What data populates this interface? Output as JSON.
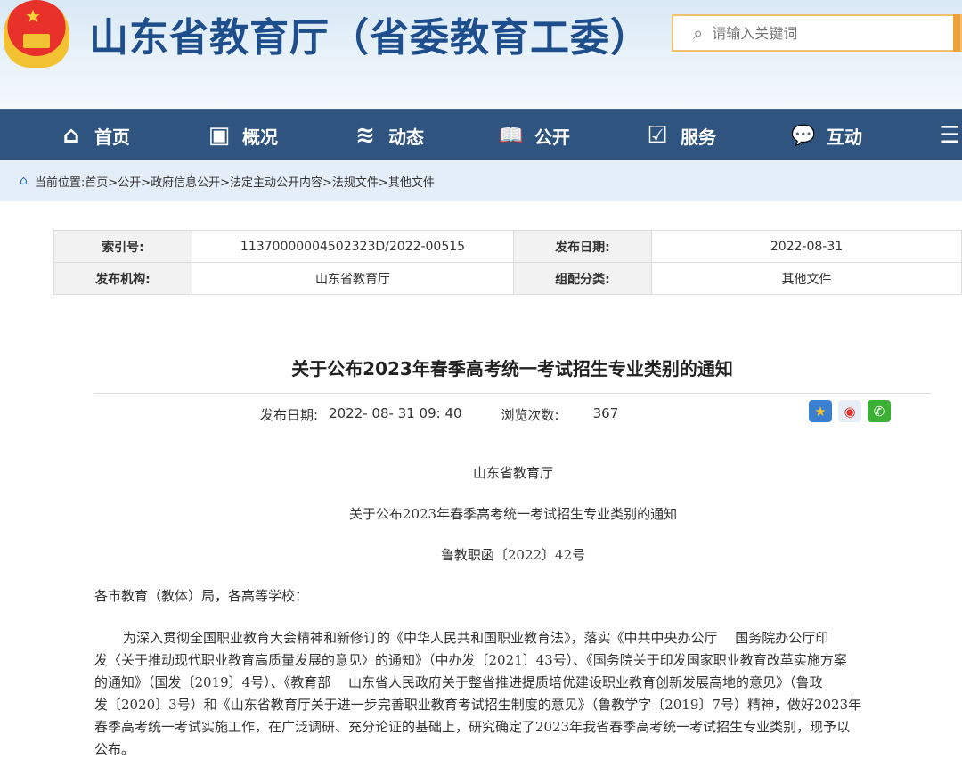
{
  "header": {
    "site_title": "山东省教育厅（省委教育工委）",
    "search_placeholder": "请输入关键词"
  },
  "nav": [
    {
      "label": "首页",
      "icon": "home-icon",
      "glyph": "⌂"
    },
    {
      "label": "概况",
      "icon": "overview-icon",
      "glyph": "▣"
    },
    {
      "label": "动态",
      "icon": "news-icon",
      "glyph": "≋"
    },
    {
      "label": "公开",
      "icon": "book-icon",
      "glyph": "📖"
    },
    {
      "label": "服务",
      "icon": "service-icon",
      "glyph": "☑"
    },
    {
      "label": "互动",
      "icon": "chat-icon",
      "glyph": "💬"
    },
    {
      "label": "",
      "icon": "list-icon",
      "glyph": "☰"
    }
  ],
  "breadcrumb": {
    "prefix": "当前位置:",
    "items": [
      "首页>",
      "公开>",
      "政府信息公开>",
      "法定主动公开内容>",
      "法规文件>",
      "其他文件"
    ]
  },
  "meta_table": {
    "index_label": "索引号:",
    "index_value": "11370000004502323D/2022-00515",
    "date_label": "发布日期:",
    "date_value": "2022-08-31",
    "org_label": "发布机构:",
    "org_value": "山东省教育厅",
    "cat_label": "组配分类:",
    "cat_value": "其他文件"
  },
  "article": {
    "title": "关于公布2023年春季高考统一考试招生专业类别的通知",
    "pub_label": "发布日期:",
    "pub_value": "2022- 08- 31 09: 40",
    "views_label": "浏览次数:",
    "views_value": "367",
    "issuer": "山东省教育厅",
    "doc_title": "关于公布2023年春季高考统一考试招生专业类别的通知",
    "doc_number": "鲁教职函〔2022〕42号",
    "salutation": "各市教育（教体）局，各高等学校：",
    "paragraph_lines": [
      "为深入贯彻全国职业教育大会精神和新修订的《中华人民共和国职业教育法》，落实《中共中央办公厅　 国务院办公厅印",
      "发〈关于推动现代职业教育高质量发展的意见〉的通知》（中办发〔2021〕43号）、《国务院关于印发国家职业教育改革实施方案",
      "的通知》（国发〔2019〕4号）、《教育部　 山东省人民政府关于整省推进提质培优建设职业教育创新发展高地的意见》（鲁政",
      "发〔2020〕3号）和《山东省教育厅关于进一步完善职业教育考试招生制度的意见》（鲁教学字〔2019〕7号）精神，做好2023年",
      "春季高考统一考试实施工作，在广泛调研、充分论证的基础上，研究确定了2023年我省春季高考统一考试招生专业类别，现予以",
      "公布。"
    ]
  }
}
